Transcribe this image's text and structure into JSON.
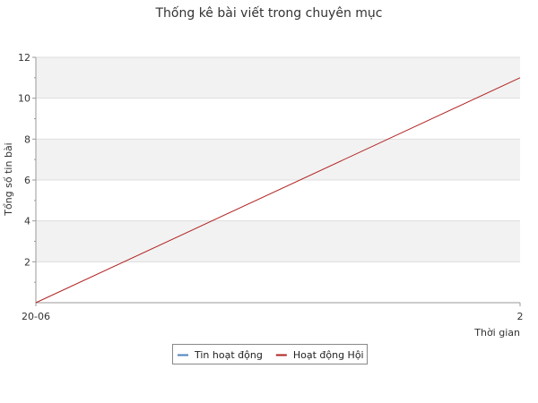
{
  "chart_data": {
    "type": "line",
    "title": "Thống kê bài viết trong chuyên mục",
    "xlabel": "Thời gian",
    "ylabel": "Tổng số tin bài",
    "x_tick_labels": [
      "20-06",
      "2"
    ],
    "ylim": [
      0,
      12
    ],
    "y_ticks": [
      2,
      4,
      6,
      8,
      10,
      12
    ],
    "grid": true,
    "legend_position": "bottom-center",
    "colors": {
      "Tin hoạt động": "#4f81bd",
      "Hoạt động Hội": "#b22222",
      "band": "#f2f2f2",
      "axis": "#999999"
    },
    "x_range": [
      0,
      1
    ],
    "series": [
      {
        "name": "Tin hoạt động",
        "points": []
      },
      {
        "name": "Hoạt động Hội",
        "points": [
          [
            0,
            0
          ],
          [
            1,
            11
          ]
        ]
      }
    ]
  }
}
